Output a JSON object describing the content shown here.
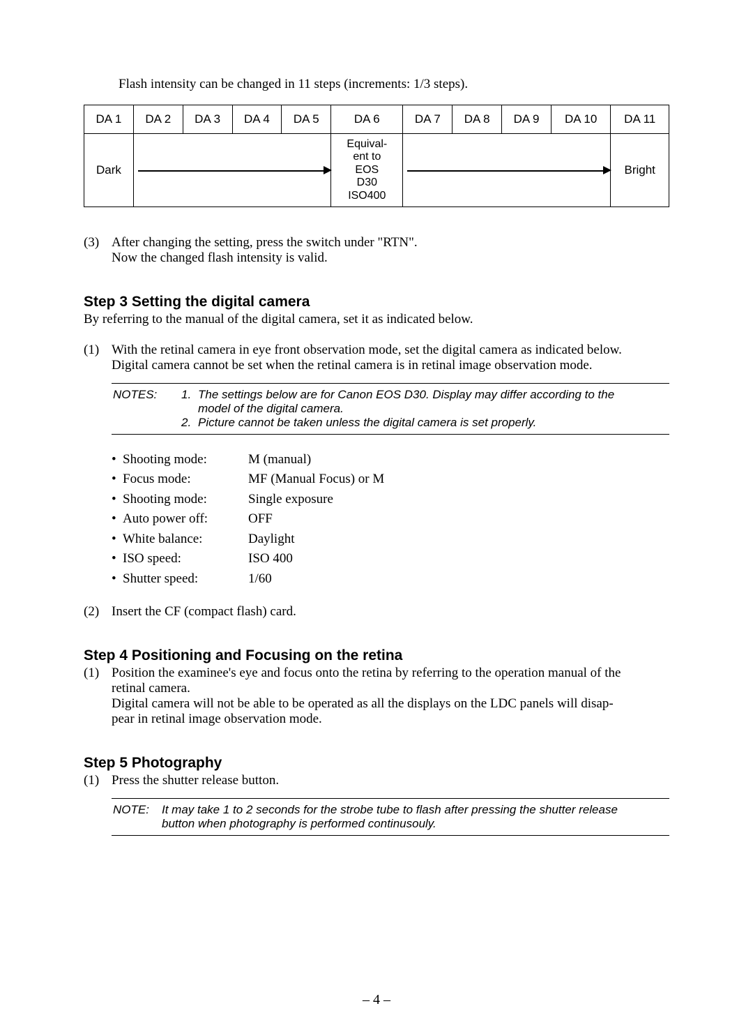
{
  "intro": "Flash intensity can be changed in 11 steps (increments: 1/3 steps).",
  "table": {
    "headers": [
      "DA 1",
      "DA 2",
      "DA 3",
      "DA 4",
      "DA 5",
      "DA 6",
      "DA 7",
      "DA 8",
      "DA 9",
      "DA 10",
      "DA 11"
    ],
    "dark": "Dark",
    "equiv": "Equival-\nent to\nEOS\nD30\nISO400",
    "bright": "Bright"
  },
  "para3": {
    "num": "(3)",
    "l1": "After changing the setting, press the switch under \"RTN\".",
    "l2": "Now the changed flash intensity is valid."
  },
  "step3": {
    "title": "Step 3  Setting the digital camera",
    "intro": "By referring to the manual of the digital camera, set it as indicated below.",
    "item1": {
      "num": "(1)",
      "l1": "With the retinal camera in eye front observation mode, set the digital camera as indicated below.",
      "l2": "Digital camera cannot be set when the retinal camera is in retinal image observation mode."
    },
    "notes_label": "NOTES:",
    "note1n": "1.",
    "note1a": "The settings below are for Canon EOS D30. Display may differ according to the",
    "note1b": "model of the digital camera.",
    "note2n": "2.",
    "note2": "Picture cannot be taken unless the digital camera is set properly.",
    "settings": [
      {
        "label": "Shooting mode:",
        "value": "M (manual)"
      },
      {
        "label": "Focus mode:",
        "value": "MF (Manual Focus) or M"
      },
      {
        "label": "Shooting mode:",
        "value": "Single exposure"
      },
      {
        "label": "Auto power off:",
        "value": "OFF"
      },
      {
        "label": "White balance:",
        "value": "Daylight"
      },
      {
        "label": "ISO speed:",
        "value": "ISO 400"
      },
      {
        "label": "Shutter speed:",
        "value": "1/60"
      }
    ],
    "item2": {
      "num": "(2)",
      "text": "Insert the CF (compact flash) card."
    }
  },
  "step4": {
    "title": "Step 4  Positioning and Focusing on the retina",
    "item1": {
      "num": "(1)",
      "l1": "Position the examinee's eye and focus onto the retina by referring to the operation manual of the",
      "l2": "retinal camera.",
      "l3": "Digital camera will not be able to be operated as all the displays on the LDC panels will disap-",
      "l4": "pear in retinal image observation mode."
    }
  },
  "step5": {
    "title": "Step 5  Photography",
    "item1": {
      "num": "(1)",
      "text": "Press the shutter release button."
    },
    "note_label": "NOTE:",
    "note_a": "It may take 1 to 2 seconds for the strobe tube to flash after pressing the shutter release",
    "note_b": "button when photography is performed continusouly."
  },
  "page_number": "– 4 –"
}
